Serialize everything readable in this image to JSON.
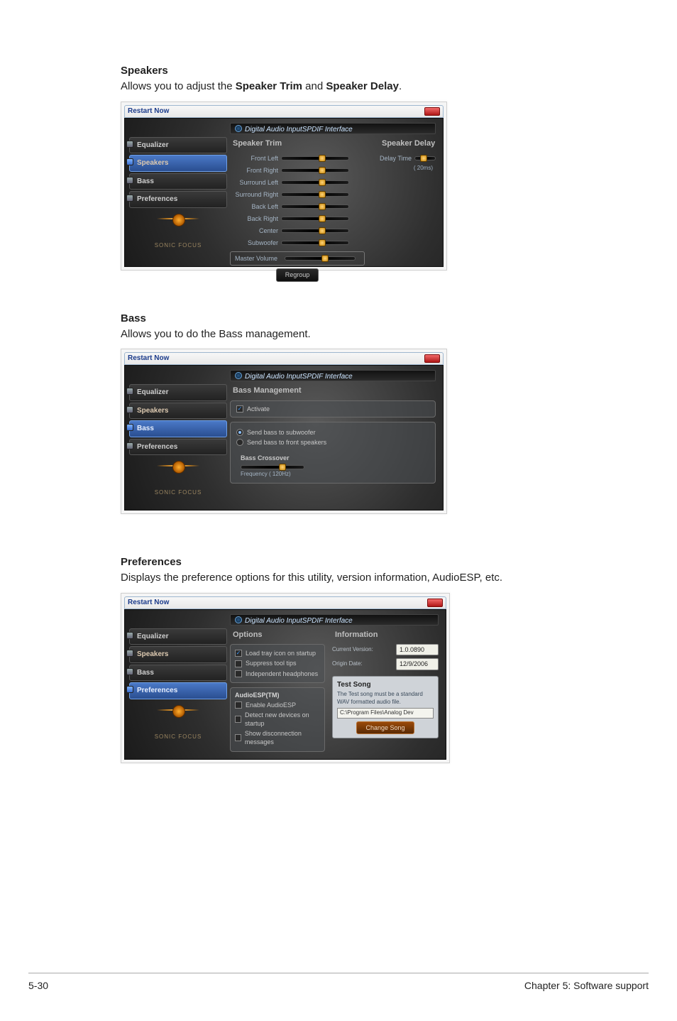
{
  "sections": {
    "speakers": {
      "title": "Speakers",
      "desc_pre": "Allows you to adjust the ",
      "desc_b1": "Speaker Trim",
      "desc_mid": " and ",
      "desc_b2": "Speaker Delay",
      "desc_post": "."
    },
    "bass": {
      "title": "Bass",
      "desc": "Allows you to do the Bass management."
    },
    "prefs": {
      "title": "Preferences",
      "desc": "Displays the preference options for this utility, version information, AudioESP, etc."
    }
  },
  "common": {
    "window_title": "Restart Now",
    "app_title": "Digital Audio InputSPDIF Interface",
    "brand": "SONIC FOCUS"
  },
  "tabs": {
    "equalizer": "Equalizer",
    "speakers": "Speakers",
    "bass": "Bass",
    "preferences": "Preferences"
  },
  "speakers_panel": {
    "trim_title": "Speaker Trim",
    "delay_title": "Speaker Delay",
    "labels": {
      "front_left": "Front Left",
      "front_right": "Front Right",
      "surround_left": "Surround Left",
      "surround_right": "Surround Right",
      "back_left": "Back Left",
      "back_right": "Back Right",
      "center": "Center",
      "subwoofer": "Subwoofer",
      "delay_time": "Delay Time",
      "delay_unit": "( 20ms)",
      "master": "Master Volume"
    },
    "regroup_btn": "Regroup"
  },
  "bass_panel": {
    "title": "Bass Management",
    "activate": "Activate",
    "opt_sub": "Send bass to subwoofer",
    "opt_front": "Send bass to front speakers",
    "crossover_title": "Bass Crossover",
    "freq_label": "Frequency  ( 120Hz)"
  },
  "prefs_panel": {
    "options_title": "Options",
    "info_title": "Information",
    "opt_tray": "Load tray icon on startup",
    "opt_tooltips": "Suppress tool tips",
    "opt_headphones": "Independent headphones",
    "esp_title": "AudioESP(TM)",
    "esp_enable": "Enable AudioESP",
    "esp_detect": "Detect new devices on startup",
    "esp_disconnect": "Show disconnection messages",
    "cur_version_label": "Current Version:",
    "cur_version_value": "1.0.0890",
    "origin_date_label": "Origin Date:",
    "origin_date_value": "12/9/2006",
    "test_title": "Test Song",
    "test_desc": "The Test song must be a standard WAV formatted audio file.",
    "test_path": "C:\\Program Files\\Analog Dev",
    "change_btn": "Change Song"
  },
  "footer": {
    "left": "5-30",
    "right": "Chapter 5: Software support"
  }
}
